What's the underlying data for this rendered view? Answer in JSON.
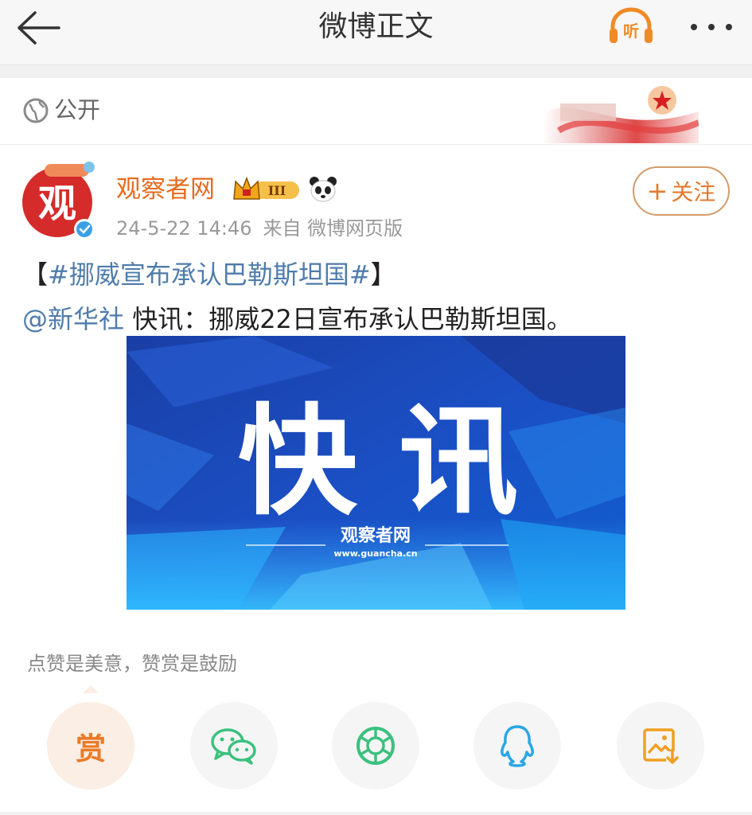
{
  "header": {
    "title": "微博正文",
    "listen_label": "听"
  },
  "visibility": {
    "label": "公开"
  },
  "post": {
    "author": "观察者网",
    "avatar_text": "观",
    "badge_level": "III",
    "time": "24-5-22 14:46",
    "source": "来自 微博网页版",
    "follow_label": "关注",
    "line1_open": "【",
    "topic": "#挪威宣布承认巴勒斯坦国#",
    "line1_close": "】",
    "mention": "@新华社",
    "line2_text": " 快讯：挪威22日宣布承认巴勒斯坦国。",
    "image": {
      "headline": "快 讯",
      "brand": "观察者网",
      "url": "www.guancha.cn"
    }
  },
  "reward": {
    "hint": "点赞是美意，赞赏是鼓励",
    "reward_label": "赏"
  },
  "share_icons": [
    "wechat-icon",
    "moments-icon",
    "qq-icon",
    "save-image-icon"
  ],
  "colors": {
    "accent_orange": "#e66b1f",
    "link_blue": "#4f7cab",
    "wechat_green": "#3cc17e",
    "qq_blue": "#2aa6e6",
    "save_orange": "#f0a020"
  }
}
